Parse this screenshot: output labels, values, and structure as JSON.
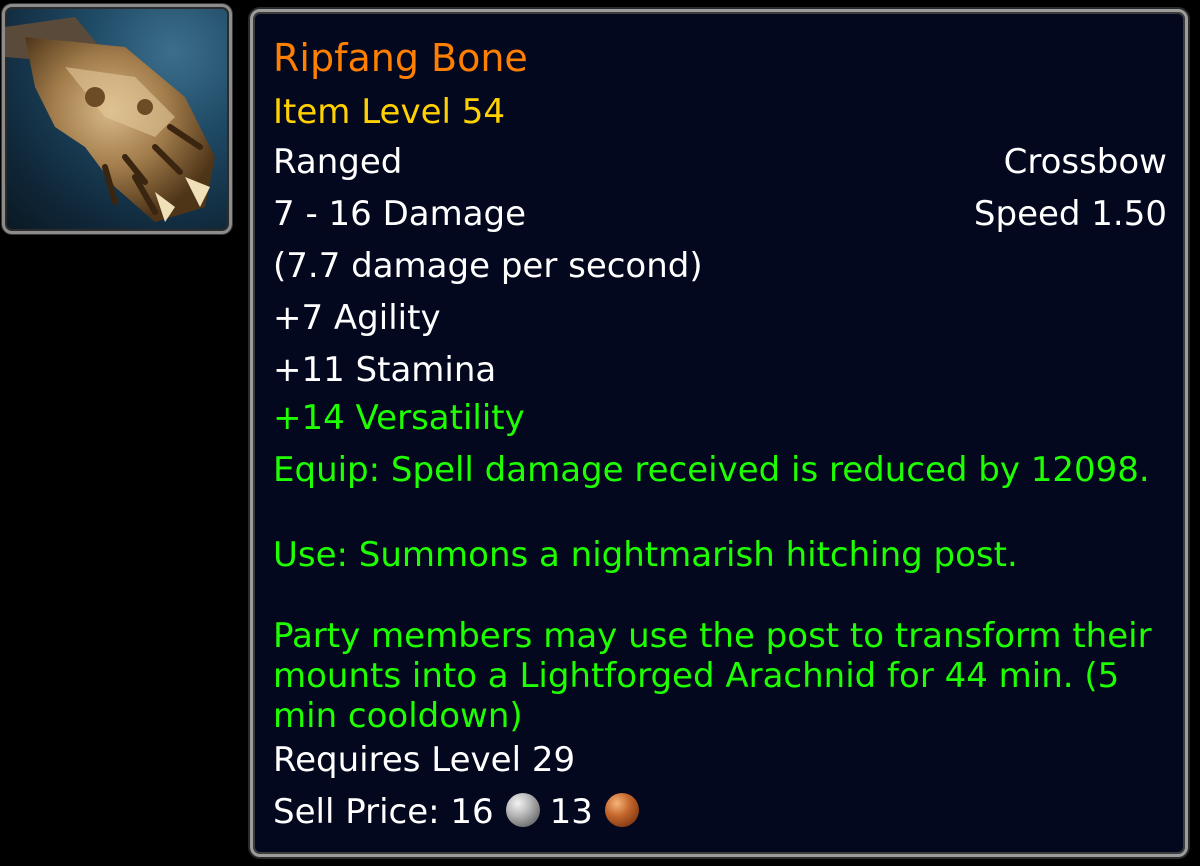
{
  "item": {
    "icon": "crossbow-bone-icon",
    "name": "Ripfang Bone",
    "item_level": "Item Level 54",
    "slot": "Ranged",
    "type": "Crossbow",
    "damage": "7 - 16 Damage",
    "speed": "Speed 1.50",
    "dps": "(7.7 damage per second)",
    "stats": [
      "+7 Agility",
      "+11 Stamina"
    ],
    "bonus_stat": "+14 Versatility",
    "equip_effect": "Equip: Spell damage received is reduced by 12098.",
    "use_effect": "Use: Summons a nightmarish hitching post.",
    "use_effect_detail": "Party members may use the post to transform their mounts into a Lightforged Arachnid for 44 min. (5 min cooldown)",
    "requires": "Requires Level 29",
    "sell_price_label": "Sell Price: 16",
    "sell_copper": "13"
  },
  "colors": {
    "name": "#ff8000",
    "item_level": "#ffd100",
    "white_text": "#ffffff",
    "green_text": "#1eff00",
    "background": "#04081e",
    "border": "#9c9c9c"
  }
}
